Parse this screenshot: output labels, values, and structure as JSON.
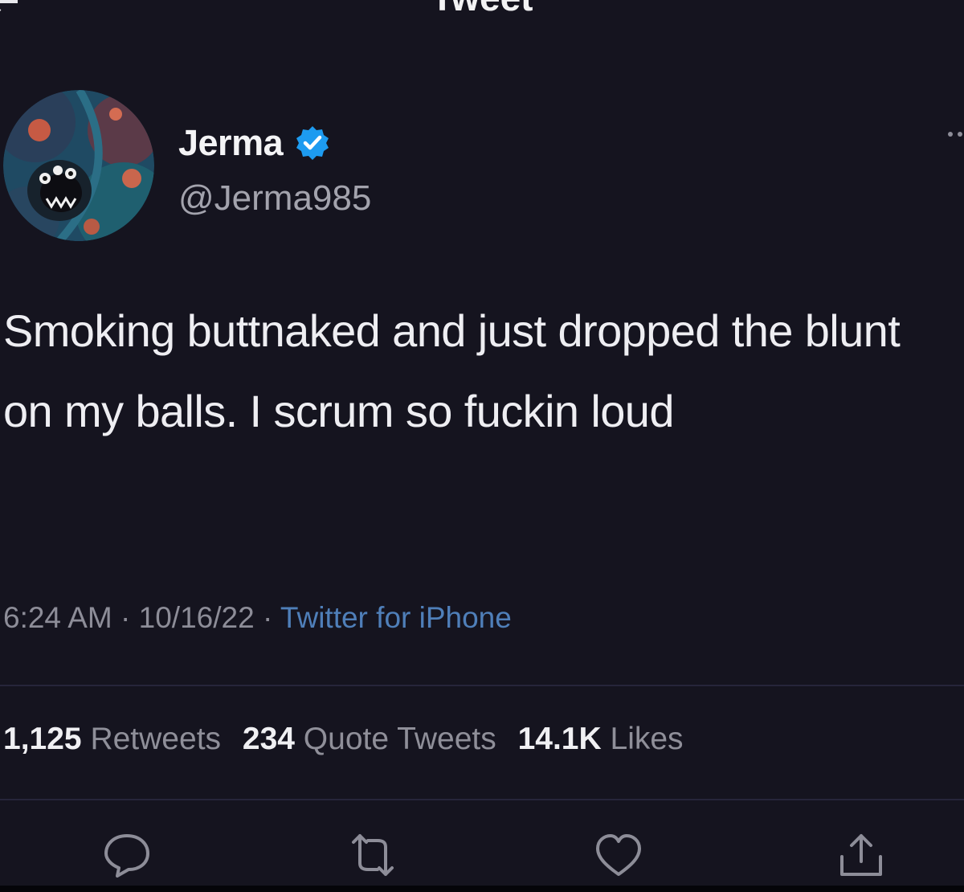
{
  "header": {
    "title": "Tweet",
    "back_icon": "arrow-left-icon"
  },
  "author": {
    "display_name": "Jerma",
    "handle": "@Jerma985",
    "verified_icon": "verified-badge-icon",
    "avatar_icon": "avatar-image"
  },
  "tweet": {
    "text": "Smoking buttnaked and just dropped the blunt on my balls. I scrum so fuckin loud"
  },
  "meta": {
    "time": "6:24 AM",
    "separator": "·",
    "date": "10/16/22",
    "source": "Twitter for iPhone"
  },
  "stats": {
    "retweets_count": "1,125",
    "retweets_label": "Retweets",
    "quotes_count": "234",
    "quotes_label": "Quote Tweets",
    "likes_count": "14.1K",
    "likes_label": "Likes"
  },
  "actions": {
    "reply_icon": "reply-icon",
    "retweet_icon": "retweet-icon",
    "like_icon": "heart-icon",
    "share_icon": "share-icon"
  },
  "colors": {
    "background": "#15141f",
    "text": "#eeeef2",
    "secondary": "#8d8d98",
    "accent": "#4f7fb9",
    "verified": "#1d9bf0"
  }
}
